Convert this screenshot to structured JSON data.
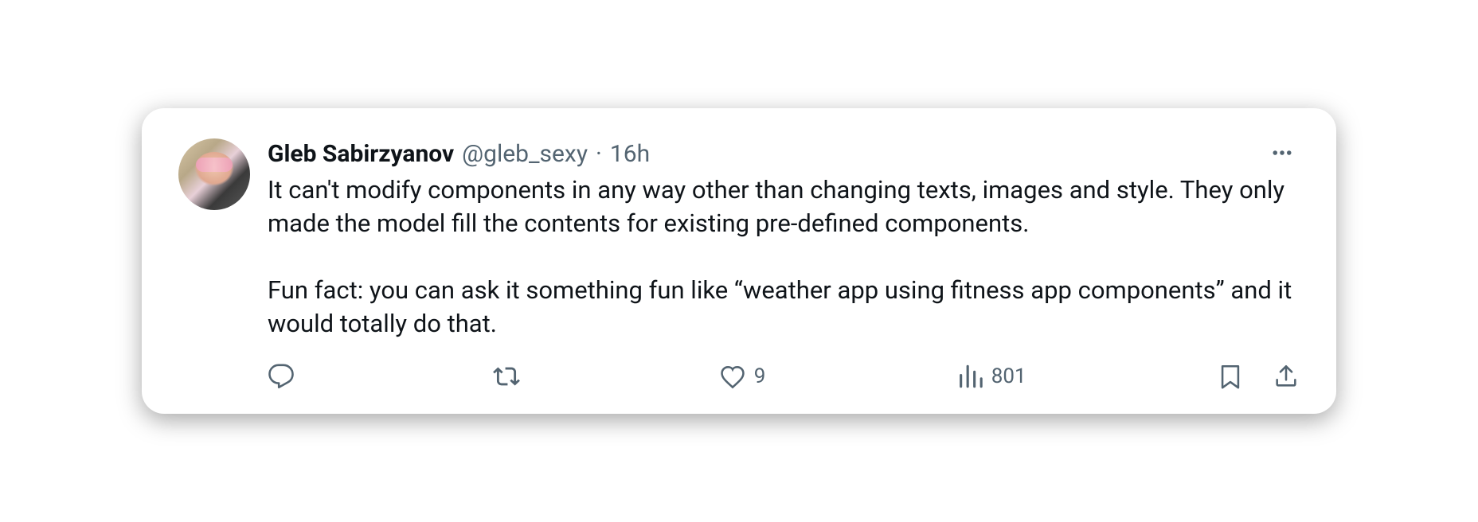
{
  "tweet": {
    "author": {
      "display_name": "Gleb Sabirzyanov",
      "handle": "@gleb_sexy"
    },
    "separator": "·",
    "timestamp": "16h",
    "text": "It can't modify components in any way other than changing texts, images and style. They only made the model fill the contents for existing pre-defined components.\n\nFun fact: you can ask it something fun like “weather app using fitness app components” and it would totally do that.",
    "metrics": {
      "replies": "",
      "retweets": "",
      "likes": "9",
      "views": "801"
    }
  }
}
